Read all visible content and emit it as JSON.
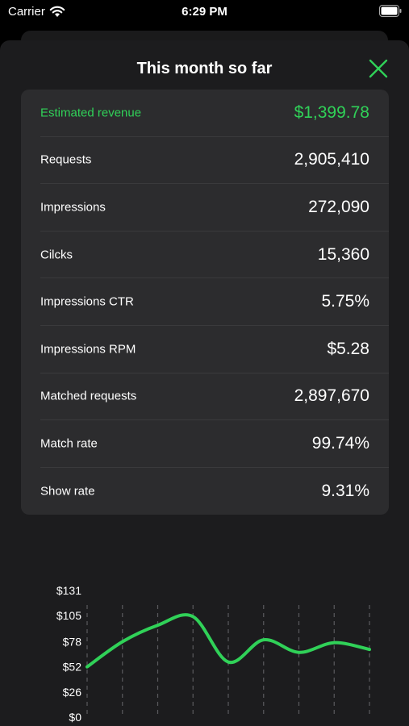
{
  "status_bar": {
    "carrier": "Carrier",
    "time": "6:29 PM"
  },
  "sheet": {
    "title": "This month so far"
  },
  "metrics": [
    {
      "label": "Estimated revenue",
      "value": "$1,399.78",
      "highlight": true
    },
    {
      "label": "Requests",
      "value": "2,905,410"
    },
    {
      "label": "Impressions",
      "value": "272,090"
    },
    {
      "label": "Cilcks",
      "value": "15,360"
    },
    {
      "label": "Impressions CTR",
      "value": "5.75%"
    },
    {
      "label": "Impressions RPM",
      "value": "$5.28"
    },
    {
      "label": "Matched requests",
      "value": "2,897,670"
    },
    {
      "label": "Match rate",
      "value": "99.74%"
    },
    {
      "label": "Show rate",
      "value": "9.31%"
    }
  ],
  "colors": {
    "accent": "#30d158",
    "background": "#1c1c1e",
    "card": "#2c2c2e"
  },
  "chart_data": {
    "type": "line",
    "y_tick_labels": [
      "$131",
      "$105",
      "$78",
      "$52",
      "$26",
      "$0"
    ],
    "y_ticks": [
      131,
      105,
      78,
      52,
      26,
      0
    ],
    "ylim": [
      0,
      131
    ],
    "x": [
      0,
      1,
      2,
      3,
      4,
      5,
      6,
      7,
      8
    ],
    "values": [
      52,
      78,
      95,
      104,
      57,
      80,
      67,
      77,
      70
    ],
    "grid": "vertical dashed",
    "series_color": "#30d158"
  }
}
